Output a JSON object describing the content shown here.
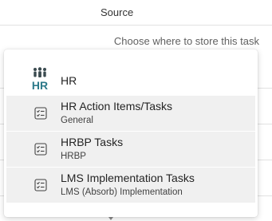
{
  "header": {
    "column_label": "Source"
  },
  "hint": {
    "text": "Choose where to store this task"
  },
  "dropdown": {
    "group": {
      "logo_label": "HR",
      "name": "HR",
      "logo_color": "#2d7a8a"
    },
    "options": [
      {
        "title": "HR Action Items/Tasks",
        "subtitle": "General",
        "icon": "task-list-icon"
      },
      {
        "title": "HRBP Tasks",
        "subtitle": "HRBP",
        "icon": "task-list-icon"
      },
      {
        "title": "LMS Implementation Tasks",
        "subtitle": "LMS (Absorb) Implementation",
        "icon": "task-list-icon"
      }
    ],
    "selected_background": "#f0f0f0"
  }
}
